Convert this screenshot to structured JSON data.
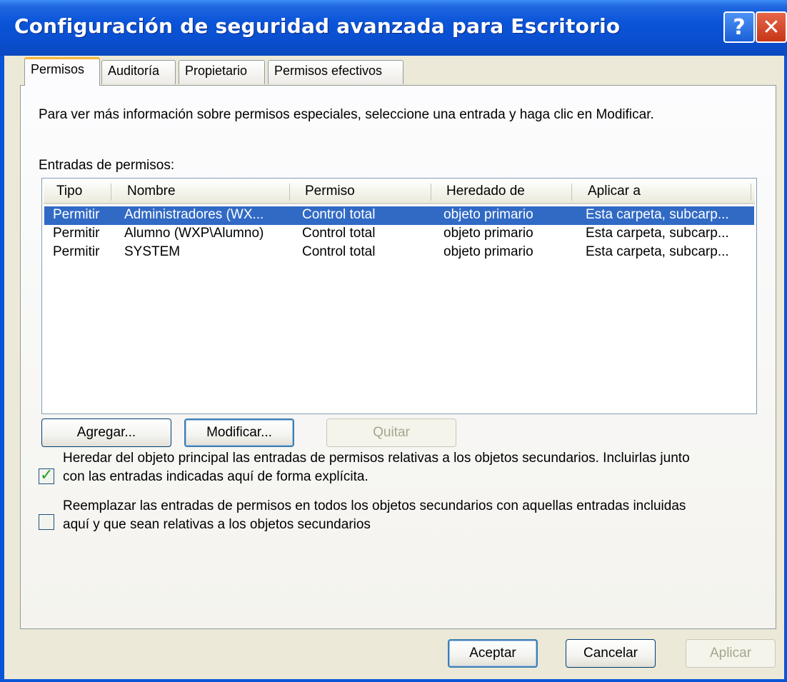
{
  "window": {
    "title": "Configuración de seguridad avanzada para Escritorio",
    "help_glyph": "?",
    "close_glyph": "✕"
  },
  "tabs": [
    {
      "label": "Permisos",
      "active": true
    },
    {
      "label": "Auditoría",
      "active": false
    },
    {
      "label": "Propietario",
      "active": false
    },
    {
      "label": "Permisos efectivos",
      "active": false
    }
  ],
  "panel": {
    "info_text": "Para ver más información sobre permisos especiales, seleccione una entrada y haga clic en Modificar.",
    "entries_label": "Entradas de permisos:"
  },
  "table": {
    "columns": [
      "Tipo",
      "Nombre",
      "Permiso",
      "Heredado de",
      "Aplicar a"
    ],
    "rows": [
      {
        "tipo": "Permitir",
        "nombre": "Administradores (WX...",
        "permiso": "Control total",
        "heredado": "objeto primario",
        "aplicar": "Esta carpeta, subcarp...",
        "selected": true
      },
      {
        "tipo": "Permitir",
        "nombre": "Alumno (WXP\\Alumno)",
        "permiso": "Control total",
        "heredado": "objeto primario",
        "aplicar": "Esta carpeta, subcarp...",
        "selected": false
      },
      {
        "tipo": "Permitir",
        "nombre": "SYSTEM",
        "permiso": "Control total",
        "heredado": "objeto primario",
        "aplicar": "Esta carpeta, subcarp...",
        "selected": false
      }
    ]
  },
  "actions": {
    "add_label": "Agregar...",
    "edit_label": "Modificar...",
    "remove_label": "Quitar"
  },
  "options": {
    "inherit_checked": true,
    "inherit_line1": "Heredar del objeto principal las entradas de permisos relativas a los objetos secundarios. Incluirlas junto",
    "inherit_line2": "con las entradas indicadas aquí de forma explícita.",
    "replace_checked": false,
    "replace_line1": "Reemplazar las entradas de permisos en todos los objetos secundarios con aquellas entradas incluidas",
    "replace_line2": "aquí y que sean relativas a los objetos secundarios"
  },
  "footer": {
    "ok_label": "Aceptar",
    "cancel_label": "Cancelar",
    "apply_label": "Aplicar"
  },
  "colors": {
    "titlebar": "#0a54d8",
    "selection": "#316ac5",
    "dialog_bg": "#ece9d8",
    "active_tab_accent": "#f9b338"
  }
}
